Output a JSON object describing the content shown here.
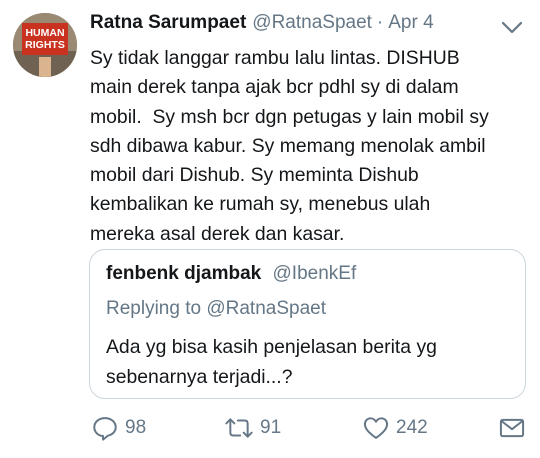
{
  "tweet": {
    "author_name": "Ratna Sarumpaet",
    "author_handle": "@RatnaSpaet",
    "separator": "·",
    "date": "Apr 4",
    "avatar_sign_text": [
      "HUMAN",
      "RIGHTS"
    ],
    "body_lines": [
      "Sy tidak langgar rambu lalu lintas. DISHUB",
      "main derek tanpa ajak bcr pdhl sy di dalam",
      "mobil.  Sy msh bcr dgn petugas y lain mobil sy",
      "sdh dibawa kabur. Sy memang menolak ambil",
      "mobil dari Dishub. Sy meminta Dishub",
      "kembalikan ke rumah sy, menebus ulah",
      "mereka asal derek dan kasar."
    ]
  },
  "quoted": {
    "author_name": "fenbenk djambak",
    "author_handle": "@IbenkEf",
    "replying_prefix": "Replying to",
    "replying_handle": "@RatnaSpaet",
    "body_lines": [
      "Ada yg bisa kasih penjelasan berita yg",
      "sebenarnya terjadi...?"
    ]
  },
  "actions": {
    "reply_count": "98",
    "retweet_count": "91",
    "like_count": "242"
  },
  "icons": {
    "reply": "reply-icon",
    "retweet": "retweet-icon",
    "like": "heart-icon",
    "share": "envelope-icon",
    "menu": "chevron-down-icon"
  },
  "colors": {
    "text": "#14171a",
    "secondary": "#657786",
    "border": "#ccd6dd",
    "avatar_sign": "#c8321f"
  }
}
